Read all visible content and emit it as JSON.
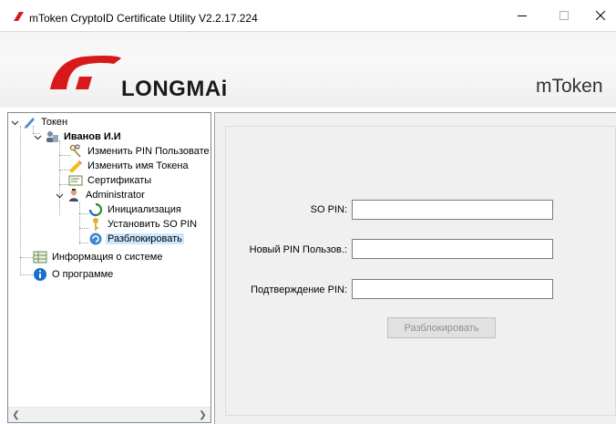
{
  "window": {
    "title": "mToken CryptoID Certificate Utility  V2.2.17.224",
    "controls": [
      "minimize-icon",
      "maximize-icon",
      "close-icon"
    ]
  },
  "banner": {
    "brand": "LONGMAi",
    "product": "mToken"
  },
  "tree": {
    "items": [
      {
        "label": "Токен",
        "icon": "pen-icon",
        "expanded": true
      },
      {
        "label": "Иванов И.И",
        "icon": "user-token-icon",
        "expanded": true,
        "bold": true
      },
      {
        "label": "Изменить PIN Пользовате",
        "icon": "keys-icon"
      },
      {
        "label": "Изменить имя Токена",
        "icon": "pencil-icon"
      },
      {
        "label": "Сертификаты",
        "icon": "certificate-icon"
      },
      {
        "label": "Administrator",
        "icon": "admin-icon",
        "expanded": true
      },
      {
        "label": "Инициализация",
        "icon": "refresh-icon"
      },
      {
        "label": "Установить SO PIN",
        "icon": "key-icon"
      },
      {
        "label": "Разблокировать",
        "icon": "unlock-icon",
        "selected": true
      },
      {
        "label": "Информация о системе",
        "icon": "table-icon"
      },
      {
        "label": "О программе",
        "icon": "info-icon"
      }
    ]
  },
  "form": {
    "so_pin_label": "SO PIN:",
    "so_pin_value": "",
    "new_pin_label": "Новый PIN Пользов.:",
    "new_pin_value": "",
    "confirm_pin_label": "Подтверждение PIN:",
    "confirm_pin_value": "",
    "unlock_button": "Разблокировать"
  },
  "colors": {
    "selection": "#cce8ff",
    "logo_red": "#d7191c",
    "panel_bg": "#f0f0f0"
  }
}
